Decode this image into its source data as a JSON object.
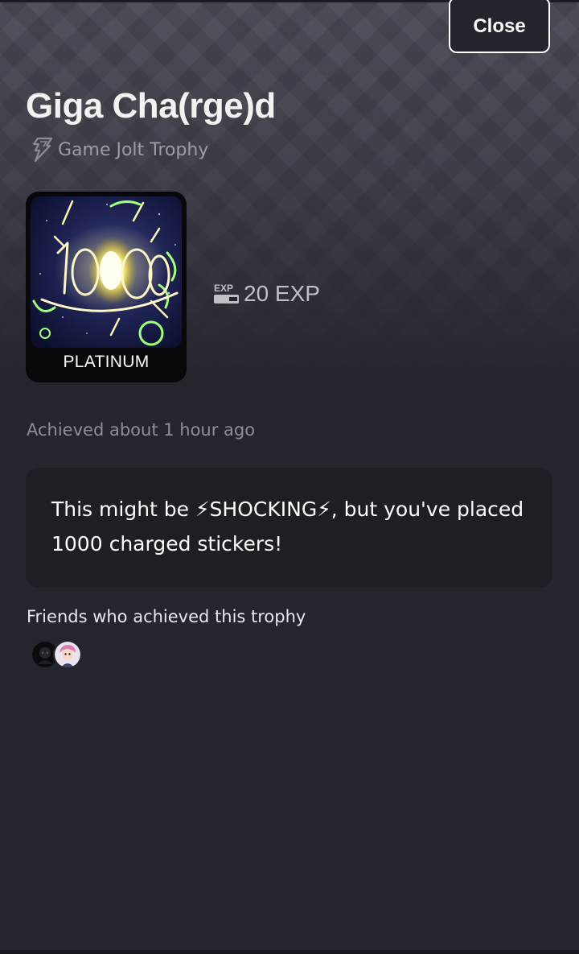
{
  "header": {
    "close_label": "Close"
  },
  "trophy": {
    "title": "Giga Cha(rge)d",
    "type_label": "Game Jolt Trophy",
    "tier": "PLATINUM",
    "exp": "20 EXP",
    "achieved": "Achieved about 1 hour ago",
    "description": "This might be ⚡SHOCKING⚡, but you've placed 1000 charged stickers!"
  },
  "friends": {
    "heading": "Friends who achieved this trophy",
    "avatars": [
      "friend-avatar-dark",
      "friend-avatar-pink-hair"
    ]
  },
  "colors": {
    "background": "#25252e",
    "card": "#1e1e25",
    "muted_text": "#8e8e96",
    "trophy_glow": "#fff27a"
  },
  "icons": [
    "game-jolt-bolt-icon",
    "exp-icon"
  ]
}
